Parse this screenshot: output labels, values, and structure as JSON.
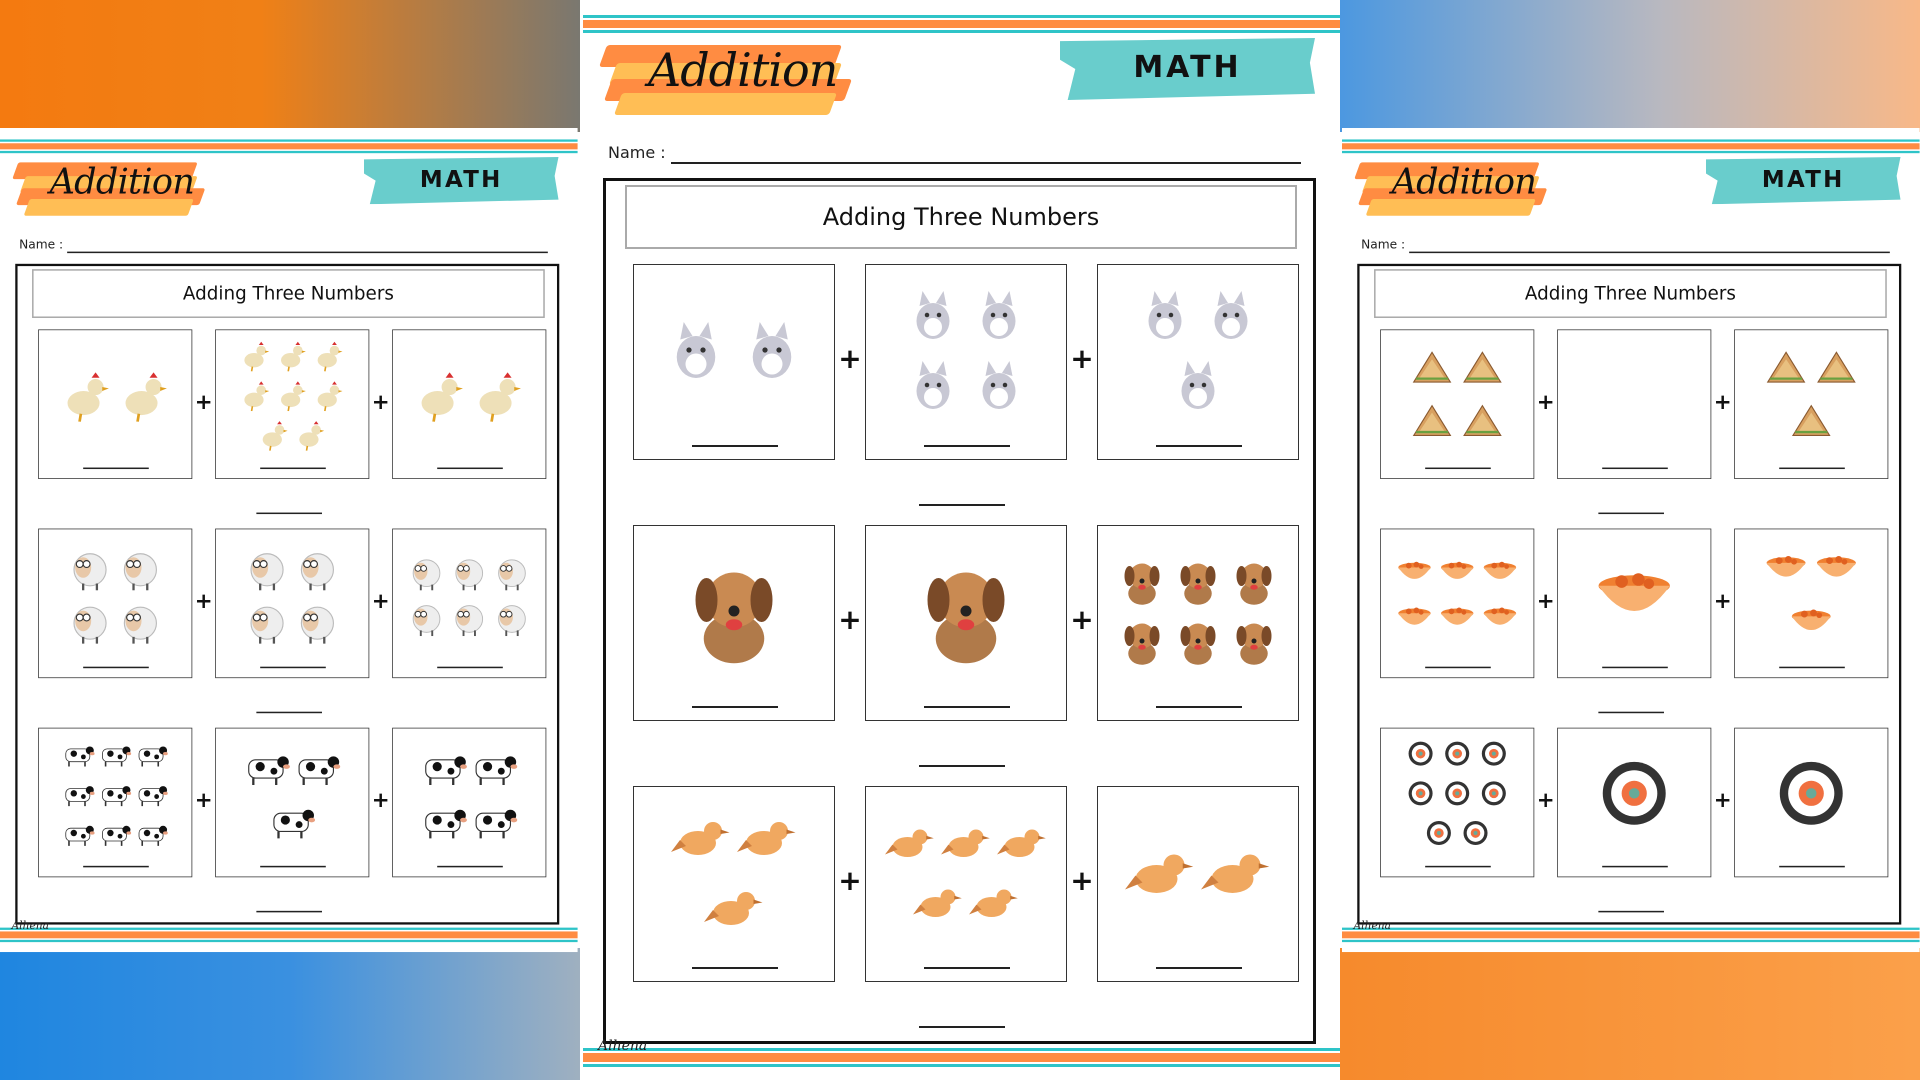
{
  "colors": {
    "orange": "#ff8c42",
    "light_orange": "#ffbe55",
    "teal": "#2ec4c8",
    "math_banner": "#69cdcc"
  },
  "signature": "Alhena",
  "pages": [
    {
      "id": "left",
      "title": "Addition",
      "subject": "MATH",
      "name_label": "Name :",
      "heading": "Adding Three Numbers",
      "rows": [
        {
          "item": "chicken",
          "counts": [
            2,
            8,
            2
          ]
        },
        {
          "item": "sheep",
          "counts": [
            4,
            4,
            6
          ]
        },
        {
          "item": "cow",
          "counts": [
            9,
            3,
            4
          ]
        }
      ]
    },
    {
      "id": "center",
      "title": "Addition",
      "subject": "MATH",
      "name_label": "Name :",
      "heading": "Adding Three Numbers",
      "rows": [
        {
          "item": "cat",
          "counts": [
            2,
            4,
            3
          ]
        },
        {
          "item": "dog",
          "counts": [
            1,
            1,
            6
          ]
        },
        {
          "item": "bird",
          "counts": [
            3,
            5,
            2
          ]
        }
      ]
    },
    {
      "id": "right",
      "title": "Addition",
      "subject": "MATH",
      "name_label": "Name :",
      "heading": "Adding Three Numbers",
      "rows": [
        {
          "item": "sandwich",
          "counts": [
            4,
            0,
            3
          ]
        },
        {
          "item": "bowl",
          "counts": [
            6,
            1,
            3
          ]
        },
        {
          "item": "sushi",
          "counts": [
            8,
            1,
            1
          ]
        }
      ]
    }
  ],
  "plus_sign": "+"
}
